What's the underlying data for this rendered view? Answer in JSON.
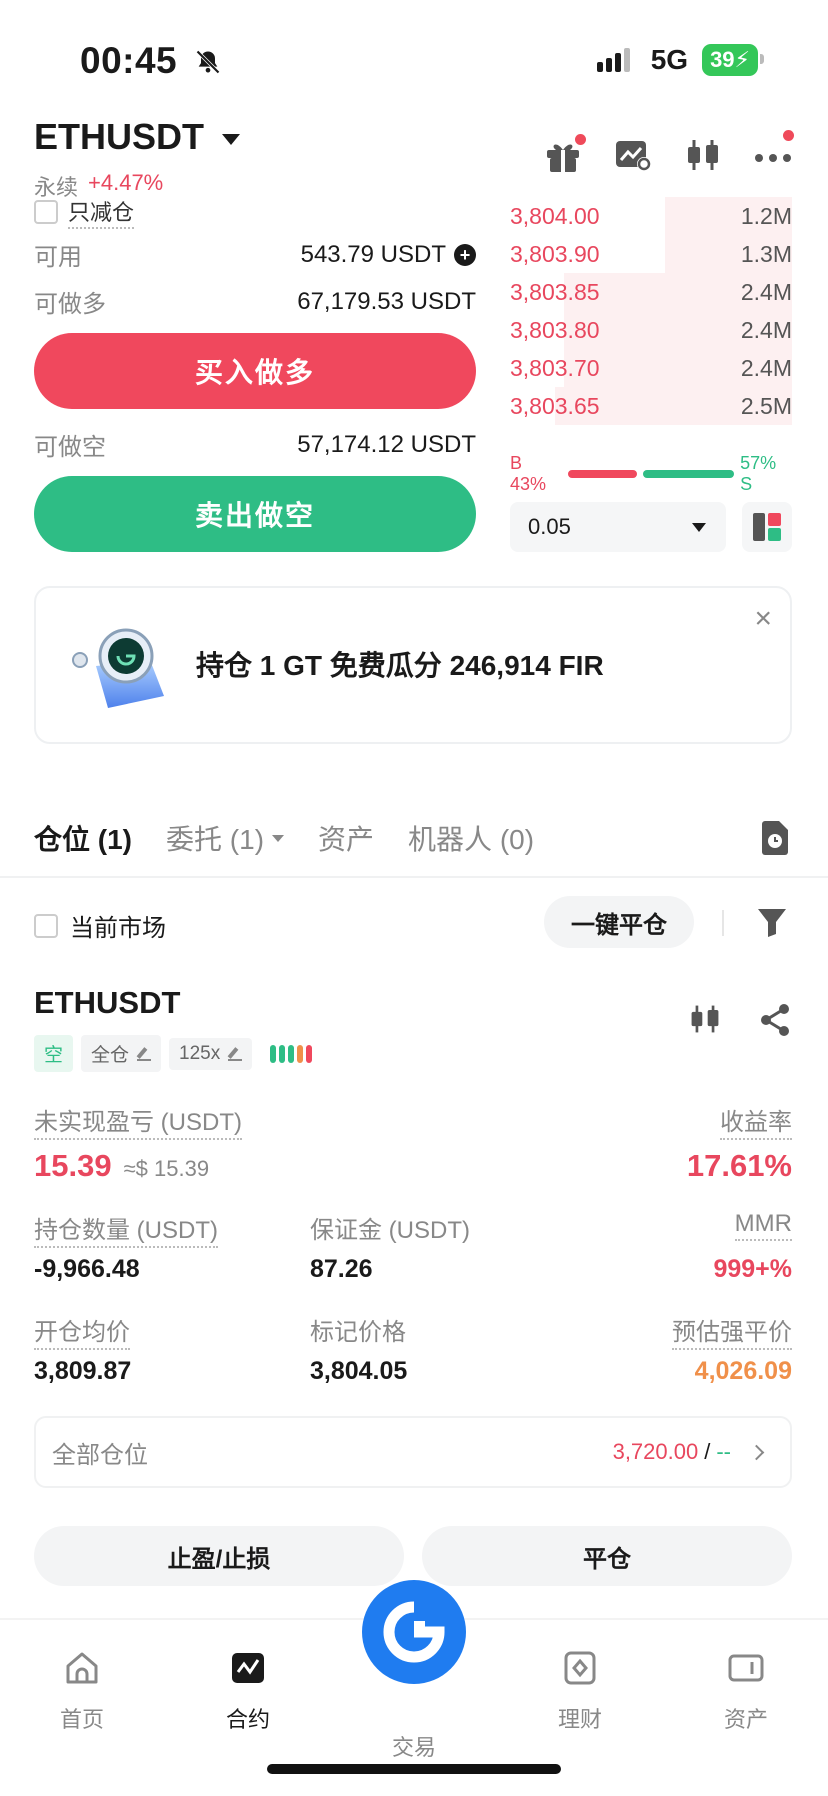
{
  "status_bar": {
    "time": "00:45",
    "network": "5G",
    "battery": "39"
  },
  "header": {
    "symbol": "ETHUSDT",
    "type": "永续",
    "change": "+4.47%"
  },
  "order_panel": {
    "reduce_only": "只减仓",
    "available_label": "可用",
    "available_value": "543.79 USDT",
    "long_label": "可做多",
    "long_value": "67,179.53 USDT",
    "buy_button": "买入做多",
    "short_label": "可做空",
    "short_value": "57,174.12 USDT",
    "sell_button": "卖出做空"
  },
  "order_book": {
    "asks": [
      {
        "price": "3,804.00",
        "size": "1.2M",
        "depth": 0.45
      },
      {
        "price": "3,803.90",
        "size": "1.3M",
        "depth": 0.45
      },
      {
        "price": "3,803.85",
        "size": "2.4M",
        "depth": 0.81
      },
      {
        "price": "3,803.80",
        "size": "2.4M",
        "depth": 0.81
      },
      {
        "price": "3,803.70",
        "size": "2.4M",
        "depth": 0.81
      },
      {
        "price": "3,803.65",
        "size": "2.5M",
        "depth": 0.84
      }
    ],
    "buy_ratio": "B 43%",
    "sell_ratio": "57% S",
    "buy_pct": 43,
    "sell_pct": 57,
    "precision": "0.05"
  },
  "promo": {
    "text": "持仓 1 GT 免费瓜分 246,914 FIR",
    "close": "×"
  },
  "tabs": [
    {
      "label": "仓位 (1)"
    },
    {
      "label": "委托 (1)"
    },
    {
      "label": "资产"
    },
    {
      "label": "机器人 (0)"
    }
  ],
  "filter": {
    "current_market": "当前市场",
    "close_all": "一键平仓"
  },
  "position": {
    "symbol": "ETHUSDT",
    "side_tag": "空",
    "margin_tag": "全仓",
    "leverage_tag": "125x",
    "pnl_label": "未实现盈亏 (USDT)",
    "pnl_value": "15.39",
    "pnl_approx": "≈$ 15.39",
    "roe_label": "收益率",
    "roe_value": "17.61%",
    "size_label": "持仓数量 (USDT)",
    "size_value": "-9,966.48",
    "margin_label": "保证金 (USDT)",
    "margin_value": "87.26",
    "mmr_label": "MMR",
    "mmr_value": "999+%",
    "entry_label": "开仓均价",
    "entry_value": "3,809.87",
    "mark_label": "标记价格",
    "mark_value": "3,804.05",
    "liq_label": "预估强平价",
    "liq_value": "4,026.09",
    "all_positions_label": "全部仓位",
    "all_positions_value": "3,720.00",
    "all_positions_sep": "/",
    "all_positions_extra": "--",
    "tpsl_button": "止盈/止损",
    "close_button": "平仓"
  },
  "nav": [
    {
      "label": "首页"
    },
    {
      "label": "合约"
    },
    {
      "label": "交易"
    },
    {
      "label": "理财"
    },
    {
      "label": "资产"
    }
  ],
  "colors": {
    "red": "#f0485d",
    "green": "#2ebd85",
    "orange": "#f0904a",
    "blue": "#1f7cf0"
  }
}
